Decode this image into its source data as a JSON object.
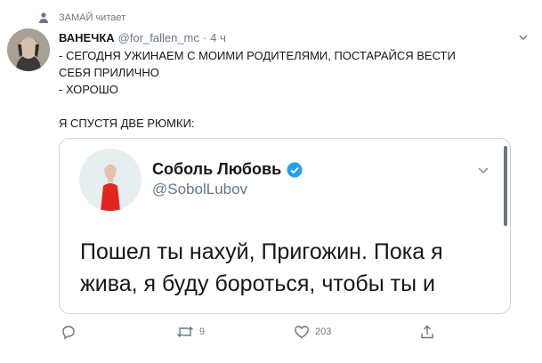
{
  "social_context": {
    "text": "ЗАМАЙ читает",
    "icon": "person-icon"
  },
  "tweet": {
    "author_name": "ВАНЕЧКА",
    "handle": "@for_fallen_mc",
    "separator": "·",
    "time": "4 ч",
    "text_lines": [
      "- СЕГОДНЯ УЖИНАЕМ С МОИМИ РОДИТЕЛЯМИ, ПОСТАРАЙСЯ ВЕСТИ",
      "СЕБЯ ПРИЛИЧНО",
      "- ХОРОШО",
      "",
      "Я СПУСТЯ ДВЕ РЮМКИ:"
    ],
    "quote": {
      "name": "Соболь Любовь",
      "handle": "@SobolLubov",
      "verified": true,
      "text_lines": [
        "Пошел ты нахуй, Пригожин. Пока я",
        "жива, я буду бороться, чтобы ты и"
      ]
    },
    "actions": {
      "reply_count": "",
      "retweet_count": "9",
      "like_count": "203"
    }
  },
  "colors": {
    "secondary_text": "#657786",
    "primary_text": "#14171a",
    "verified": "#1da1f2",
    "border": "#ccd6dd"
  }
}
